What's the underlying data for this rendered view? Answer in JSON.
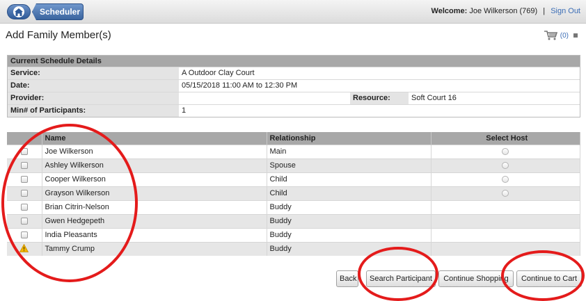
{
  "topbar": {
    "breadcrumb": "Scheduler",
    "welcome_label": "Welcome:",
    "welcome_user": "Joe Wilkerson",
    "welcome_id": "(769)",
    "separator": "|",
    "signout": "Sign Out"
  },
  "page": {
    "title": "Add Family Member(s)"
  },
  "cart": {
    "count": "(0)"
  },
  "schedule": {
    "header": "Current Schedule Details",
    "service_label": "Service:",
    "service_value": "A Outdoor Clay Court",
    "date_label": "Date:",
    "date_value": "05/15/2018 11:00 AM to 12:30 PM",
    "provider_label": "Provider:",
    "provider_value": "",
    "resource_label": "Resource:",
    "resource_value": "Soft Court 16",
    "min_label": "Min# of Participants:",
    "min_value": "1"
  },
  "members": {
    "headers": {
      "name": "Name",
      "relationship": "Relationship",
      "host": "Select Host"
    },
    "rows": [
      {
        "name": "Joe Wilkerson",
        "relationship": "Main",
        "status": "checkbox",
        "host": true
      },
      {
        "name": "Ashley Wilkerson",
        "relationship": "Spouse",
        "status": "checkbox",
        "host": true
      },
      {
        "name": "Cooper Wilkerson",
        "relationship": "Child",
        "status": "checkbox",
        "host": true
      },
      {
        "name": "Grayson Wilkerson",
        "relationship": "Child",
        "status": "checkbox",
        "host": true
      },
      {
        "name": "Brian Citrin-Nelson",
        "relationship": "Buddy",
        "status": "checkbox",
        "host": false
      },
      {
        "name": "Gwen Hedgepeth",
        "relationship": "Buddy",
        "status": "checkbox",
        "host": false
      },
      {
        "name": "India Pleasants",
        "relationship": "Buddy",
        "status": "checkbox",
        "host": false
      },
      {
        "name": "Tammy Crump",
        "relationship": "Buddy",
        "status": "warning",
        "host": false
      }
    ]
  },
  "buttons": {
    "back": "Back",
    "search": "Search Participant",
    "continue_shopping": "Continue Shopping",
    "continue_cart": "Continue to Cart"
  },
  "colors": {
    "accent": "#3a6cb5",
    "annotation": "#e41b1b",
    "header_gray": "#a8a8a8",
    "warning": "#f2b705"
  },
  "icons": [
    "home-icon",
    "cart-icon",
    "warning-icon"
  ]
}
